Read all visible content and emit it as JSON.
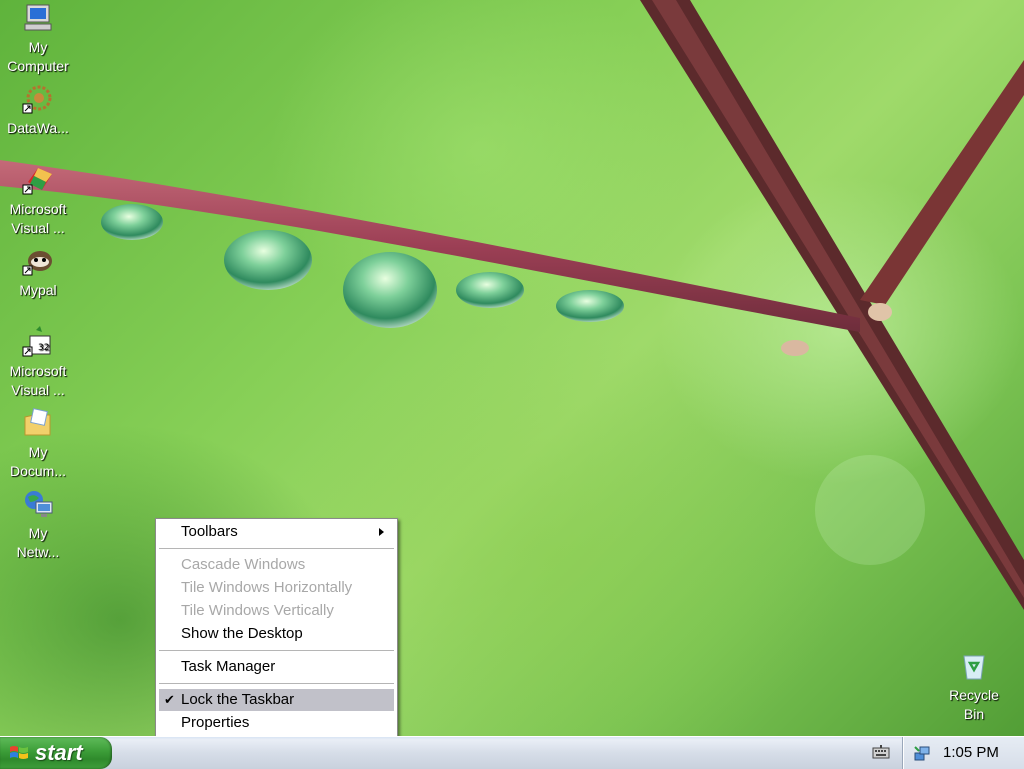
{
  "desktop": {
    "icons": [
      {
        "id": "my-computer",
        "label_line1": "My",
        "label_line2": "Computer"
      },
      {
        "id": "datawa",
        "label_line1": "DataWa..."
      },
      {
        "id": "ms-visual-1",
        "label_line1": "Microsoft",
        "label_line2": "Visual ..."
      },
      {
        "id": "mypal",
        "label_line1": "Mypal"
      },
      {
        "id": "ms-visual-2",
        "label_line1": "Microsoft",
        "label_line2": "Visual ..."
      },
      {
        "id": "my-documents",
        "label_line1": "My",
        "label_line2": "Docum..."
      },
      {
        "id": "my-network",
        "label_line1": "My",
        "label_line2": "Netw..."
      },
      {
        "id": "recycle-bin",
        "label_line1": "Recycle",
        "label_line2": "Bin"
      }
    ]
  },
  "context_menu": {
    "items": [
      {
        "label": "Toolbars",
        "state": "submenu"
      },
      {
        "label": "Cascade Windows",
        "state": "disabled"
      },
      {
        "label": "Tile Windows Horizontally",
        "state": "disabled"
      },
      {
        "label": "Tile Windows Vertically",
        "state": "disabled"
      },
      {
        "label": "Show the Desktop",
        "state": "enabled"
      },
      {
        "label": "Task Manager",
        "state": "enabled"
      },
      {
        "label": "Lock the Taskbar",
        "state": "checked-highlighted"
      },
      {
        "label": "Properties",
        "state": "enabled"
      }
    ]
  },
  "taskbar": {
    "start_label": "start",
    "clock": "1:05 PM",
    "tray_icons": [
      "keyboard-icon",
      "network-icon"
    ]
  },
  "colors": {
    "start_green": "#3c9d38",
    "menu_highlight": "#c1c1c9",
    "disabled_text": "#a8a8a8"
  }
}
